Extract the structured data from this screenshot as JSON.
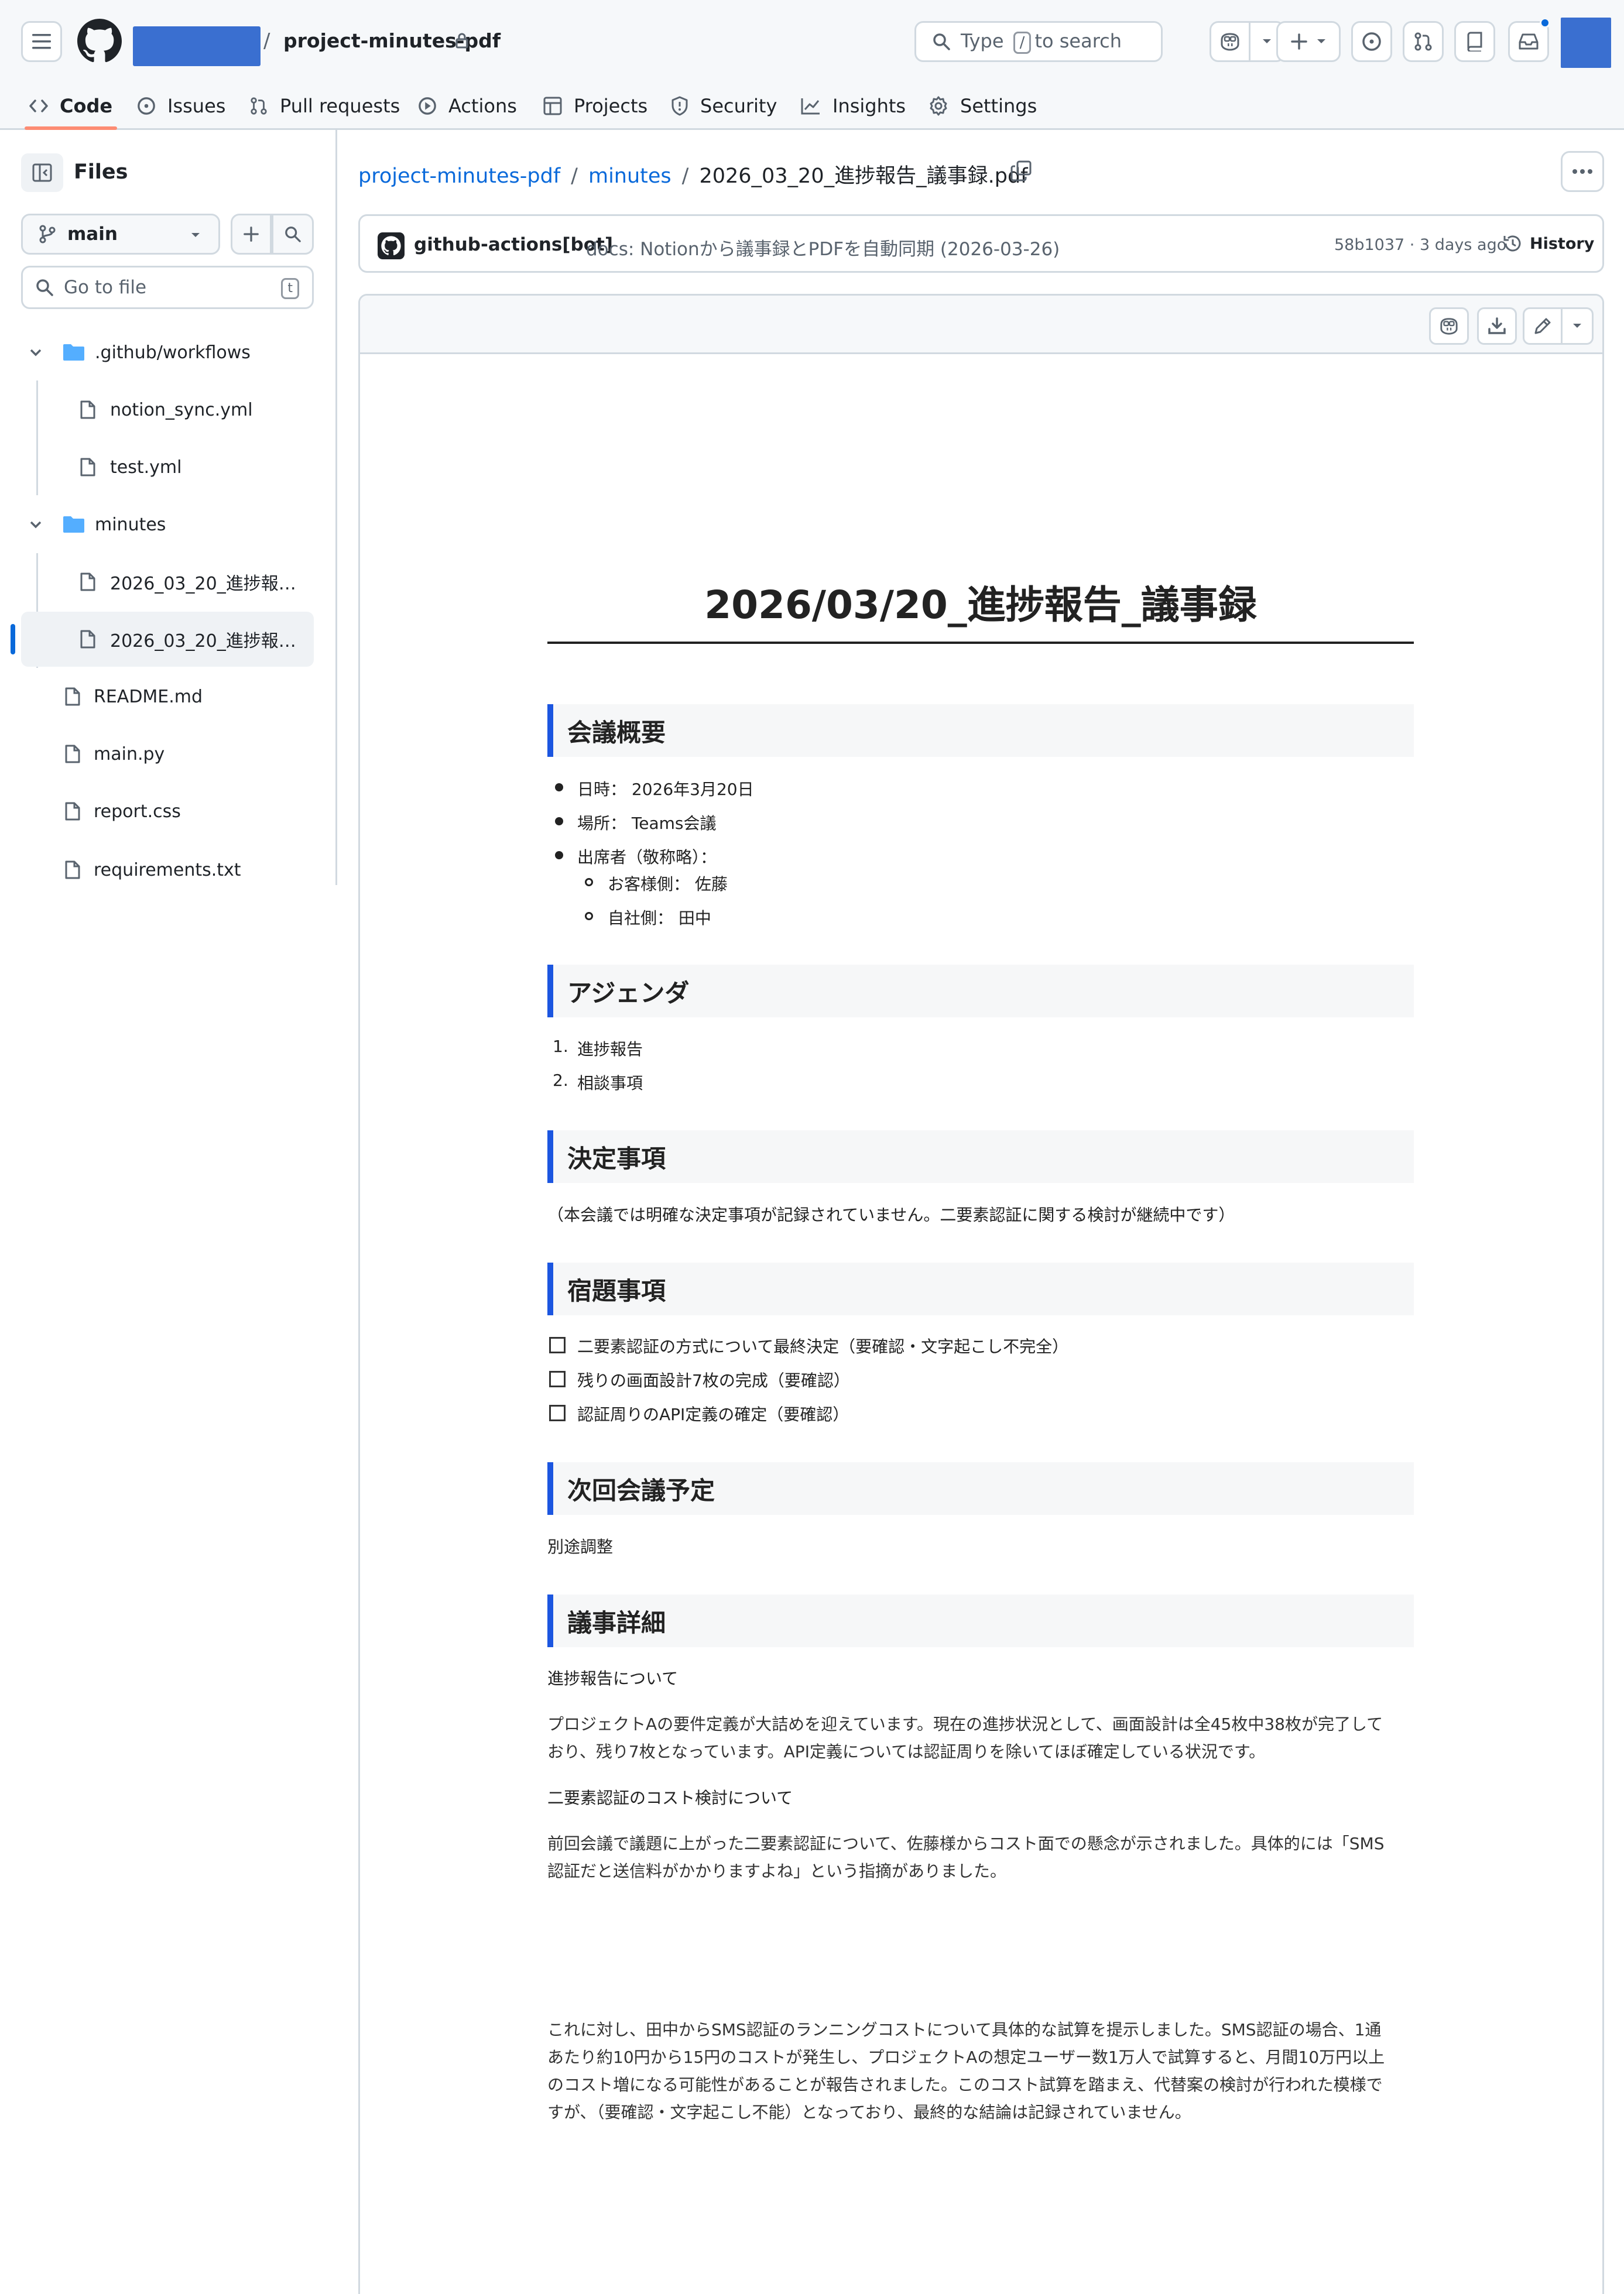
{
  "header": {
    "repo_name": "project-minutes-pdf",
    "separator": "/",
    "search": {
      "prefix": "Type",
      "key": "/",
      "suffix": "to search"
    }
  },
  "tabs": [
    {
      "label": "Code",
      "icon": "code-icon",
      "active": true
    },
    {
      "label": "Issues",
      "icon": "issue-icon"
    },
    {
      "label": "Pull requests",
      "icon": "pull-request-icon"
    },
    {
      "label": "Actions",
      "icon": "play-icon"
    },
    {
      "label": "Projects",
      "icon": "table-icon"
    },
    {
      "label": "Security",
      "icon": "shield-icon"
    },
    {
      "label": "Insights",
      "icon": "graph-icon"
    },
    {
      "label": "Settings",
      "icon": "gear-icon"
    }
  ],
  "sidebar": {
    "title": "Files",
    "branch": "main",
    "goto_placeholder": "Go to file",
    "goto_key": "t",
    "tree": [
      {
        "label": ".github/workflows",
        "type": "folder",
        "expanded": true
      },
      {
        "label": "notion_sync.yml",
        "type": "file"
      },
      {
        "label": "test.yml",
        "type": "file"
      },
      {
        "label": "minutes",
        "type": "folder",
        "expanded": true
      },
      {
        "label": "2026_03_20_進捗報告...",
        "type": "file"
      },
      {
        "label": "2026_03_20_進捗報告...",
        "type": "file",
        "selected": true
      },
      {
        "label": "README.md",
        "type": "file"
      },
      {
        "label": "main.py",
        "type": "file"
      },
      {
        "label": "report.css",
        "type": "file"
      },
      {
        "label": "requirements.txt",
        "type": "file"
      }
    ]
  },
  "breadcrumb": {
    "repo": "project-minutes-pdf",
    "folder": "minutes",
    "file": "2026_03_20_進捗報告_議事録.pdf"
  },
  "commit": {
    "author": "github-actions[bot]",
    "message": "docs: Notionから議事録とPDFを自動同期 (2026-03-26)",
    "meta": "58b1037 · 3 days ago",
    "history_label": "History"
  },
  "document": {
    "title": "2026/03/20_進捗報告_議事録",
    "overview": {
      "heading": "会議概要",
      "date": "日時： 2026年3月20日",
      "place": "場所： Teams会議",
      "attendees": "出席者（敬称略）：",
      "client": "お客様側： 佐藤",
      "company": "自社側： 田中"
    },
    "agenda": {
      "heading": "アジェンダ",
      "items": [
        "進捗報告",
        "相談事項"
      ]
    },
    "decisions": {
      "heading": "決定事項",
      "text": "（本会議では明確な決定事項が記録されていません。二要素認証に関する検討が継続中です）"
    },
    "tasks": {
      "heading": "宿題事項",
      "items": [
        "二要素認証の方式について最終決定（要確認・文字起こし不完全）",
        "残りの画面設計7枚の完成（要確認）",
        "認証周りのAPI定義の確定（要確認）"
      ]
    },
    "next_meeting": {
      "heading": "次回会議予定",
      "text": "別途調整"
    },
    "details": {
      "heading": "議事詳細",
      "sub1": "進捗報告について",
      "para1_l1": "プロジェクトAの要件定義が大詰めを迎えています。現在の進捗状況として、画面設計は全45枚中38枚が完了して",
      "para1_l2": "おり、残り7枚となっています。API定義については認証周りを除いてほぼ確定している状況です。",
      "sub2": "二要素認証のコスト検討について",
      "para2_l1": "前回会議で議題に上がった二要素認証について、佐藤様からコスト面での懸念が示されました。具体的には「SMS",
      "para2_l2": "認証だと送信料がかかりますよね」という指摘がありました。",
      "para3_l1": "これに対し、田中からSMS認証のランニングコストについて具体的な試算を提示しました。SMS認証の場合、1通",
      "para3_l2": "あたり約10円から15円のコストが発生し、プロジェクトAの想定ユーザー数1万人で試算すると、月間10万円以上",
      "para3_l3": "のコスト増になる可能性があることが報告されました。このコスト試算を踏まえ、代替案の検討が行われた模様で",
      "para3_l4": "すが、（要確認・文字起こし不能）となっており、最終的な結論は記録されていません。"
    }
  }
}
